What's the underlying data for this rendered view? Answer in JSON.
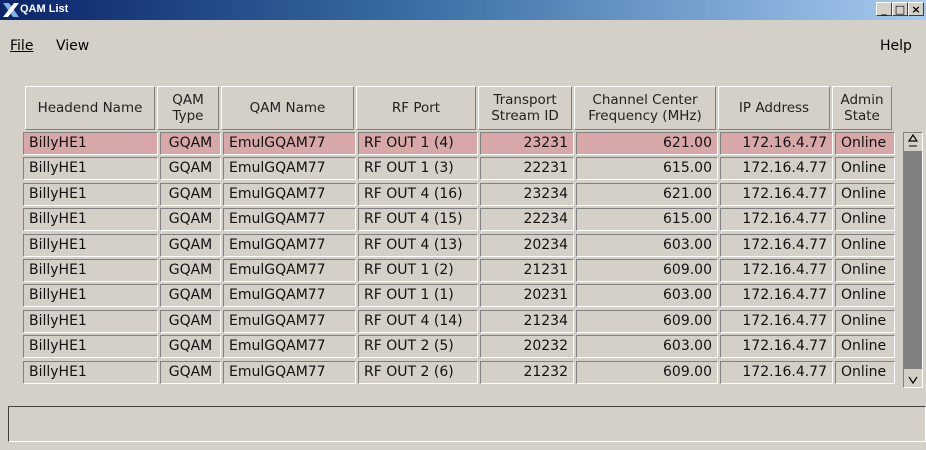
{
  "window": {
    "title": "QAM List",
    "minimize": "_",
    "maximize": "□",
    "close": "×"
  },
  "menu": {
    "file": "File",
    "view": "View",
    "help": "Help"
  },
  "table": {
    "columns": [
      "Headend Name",
      "QAM Type",
      "QAM Name",
      "RF Port",
      "Transport Stream ID",
      "Channel Center Frequency (MHz)",
      "IP Address",
      "Admin State"
    ],
    "rows": [
      [
        "BillyHE1",
        "GQAM",
        "EmulGQAM77",
        "RF OUT 1 (4)",
        "23231",
        "621.00",
        "172.16.4.77",
        "Online"
      ],
      [
        "BillyHE1",
        "GQAM",
        "EmulGQAM77",
        "RF OUT 1 (3)",
        "22231",
        "615.00",
        "172.16.4.77",
        "Online"
      ],
      [
        "BillyHE1",
        "GQAM",
        "EmulGQAM77",
        "RF OUT 4 (16)",
        "23234",
        "621.00",
        "172.16.4.77",
        "Online"
      ],
      [
        "BillyHE1",
        "GQAM",
        "EmulGQAM77",
        "RF OUT 4 (15)",
        "22234",
        "615.00",
        "172.16.4.77",
        "Online"
      ],
      [
        "BillyHE1",
        "GQAM",
        "EmulGQAM77",
        "RF OUT 4 (13)",
        "20234",
        "603.00",
        "172.16.4.77",
        "Online"
      ],
      [
        "BillyHE1",
        "GQAM",
        "EmulGQAM77",
        "RF OUT 1 (2)",
        "21231",
        "609.00",
        "172.16.4.77",
        "Online"
      ],
      [
        "BillyHE1",
        "GQAM",
        "EmulGQAM77",
        "RF OUT 1 (1)",
        "20231",
        "603.00",
        "172.16.4.77",
        "Online"
      ],
      [
        "BillyHE1",
        "GQAM",
        "EmulGQAM77",
        "RF OUT 4 (14)",
        "21234",
        "609.00",
        "172.16.4.77",
        "Online"
      ],
      [
        "BillyHE1",
        "GQAM",
        "EmulGQAM77",
        "RF OUT 2 (5)",
        "20232",
        "603.00",
        "172.16.4.77",
        "Online"
      ],
      [
        "BillyHE1",
        "GQAM",
        "EmulGQAM77",
        "RF OUT 2 (6)",
        "21232",
        "609.00",
        "172.16.4.77",
        "Online"
      ]
    ],
    "selected_row": 0
  },
  "status": {
    "text": ""
  },
  "colors": {
    "selection": "#d8a8a8",
    "titlebar": "#0a246a"
  }
}
